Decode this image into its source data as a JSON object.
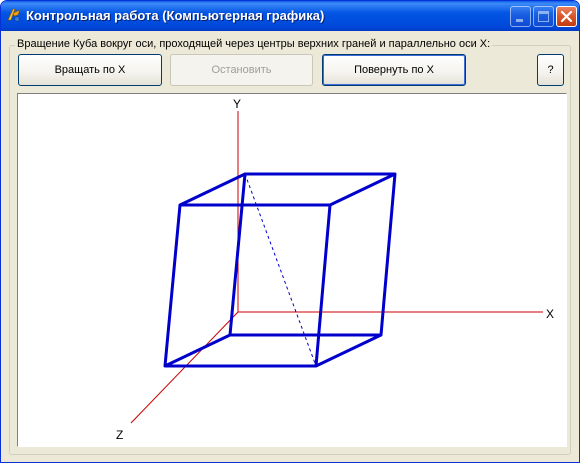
{
  "window": {
    "title": "Контрольная работа (Компьютерная графика)",
    "icon": "delphi-app-icon",
    "controls": [
      "minimize-icon",
      "maximize-icon",
      "close-icon"
    ]
  },
  "group": {
    "legend": "Вращение Куба вокруг оси, проходящей через центры верхних граней и параллельно оси X:"
  },
  "buttons": {
    "rotate": "Вращать по X",
    "stop": "Остановить",
    "turn": "Повернуть по X",
    "help": "?"
  },
  "canvas": {
    "axes": {
      "x": "X",
      "y": "Y",
      "z": "Z"
    },
    "colors": {
      "axis": "#cc0000",
      "cube": "#0000cc",
      "background": "#ffffff"
    }
  }
}
